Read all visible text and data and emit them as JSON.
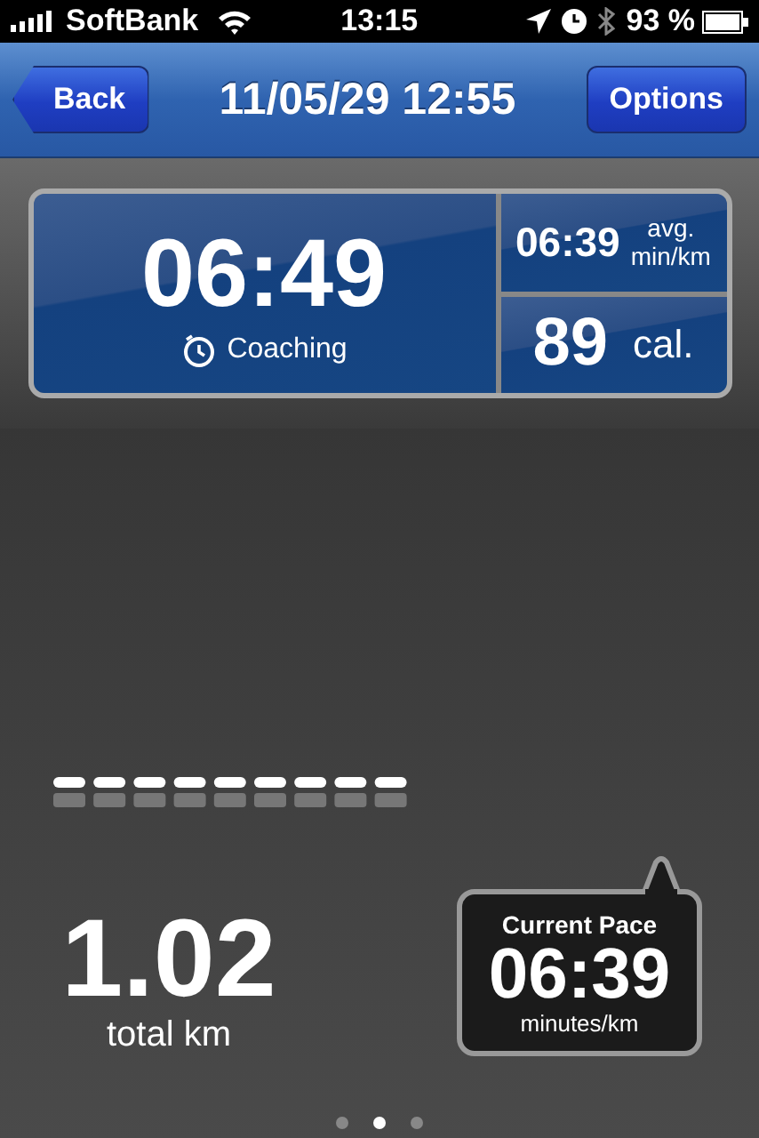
{
  "status_bar": {
    "carrier": "SoftBank",
    "time": "13:15",
    "battery": "93 %"
  },
  "nav": {
    "back": "Back",
    "title": "11/05/29 12:55",
    "options": "Options"
  },
  "summary": {
    "duration": "06:49",
    "mode": "Coaching",
    "avg_pace": "06:39",
    "avg_label_1": "avg.",
    "avg_label_2": "min/km",
    "calories": "89",
    "calories_unit": "cal."
  },
  "distance": {
    "value": "1.02",
    "unit": "total km"
  },
  "current_pace": {
    "title": "Current Pace",
    "value": "06:39",
    "unit": "minutes/km"
  },
  "pages": [
    {
      "selected": false
    },
    {
      "selected": true
    },
    {
      "selected": false
    }
  ]
}
